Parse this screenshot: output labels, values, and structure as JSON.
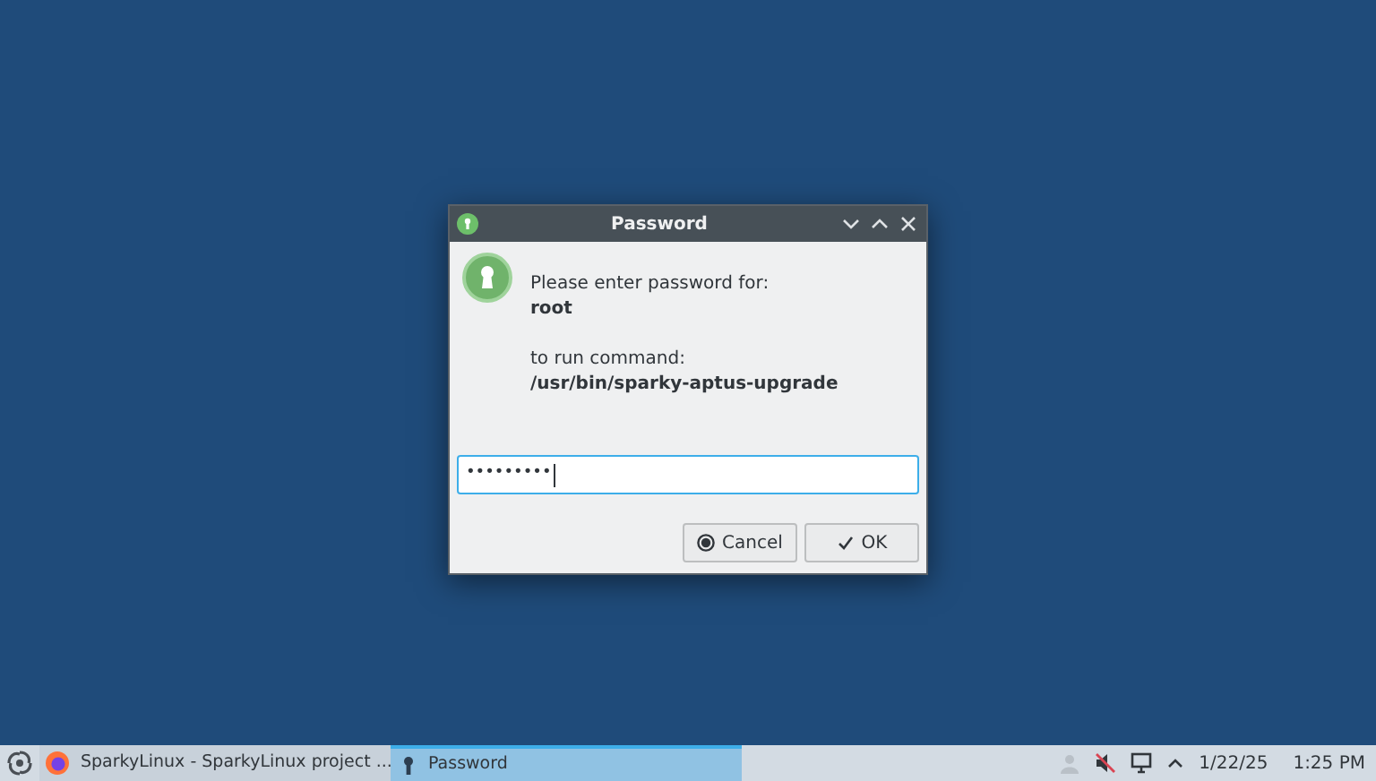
{
  "dialog": {
    "title": "Password",
    "prompt": "Please enter password for:",
    "user": "root",
    "command_label": "to run command:",
    "command": "/usr/bin/sparky-aptus-upgrade",
    "password": "•••••••••",
    "buttons": [
      {
        "kind": "cancel",
        "label": "Cancel"
      },
      {
        "kind": "ok",
        "label": "OK"
      }
    ]
  },
  "taskbar": {
    "tasks": [
      {
        "kind": "browser",
        "label": "SparkyLinux - SparkyLinux project ...",
        "selected": false
      },
      {
        "kind": "password",
        "label": "Password",
        "selected": true
      }
    ],
    "date": "1/22/25",
    "time": "1:25 PM"
  }
}
